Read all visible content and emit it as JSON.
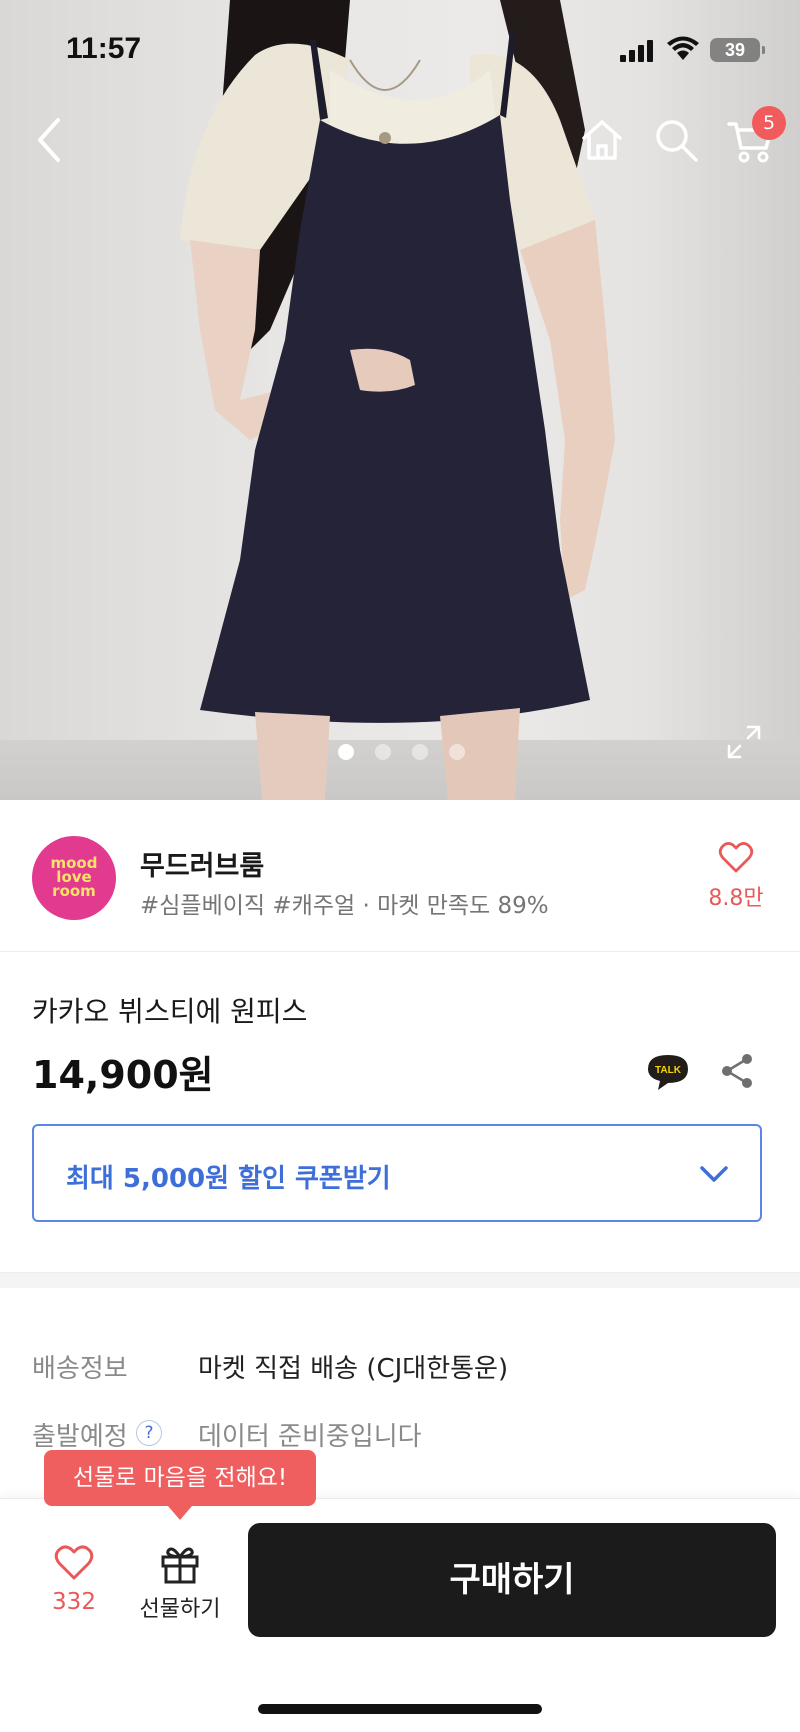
{
  "status_bar": {
    "time": "11:57",
    "battery": "39"
  },
  "cart": {
    "badge_count": "5"
  },
  "carousel": {
    "total": 4,
    "active_index": 0
  },
  "store": {
    "logo_lines": [
      "mood",
      "love",
      "room"
    ],
    "name": "무드러브룸",
    "tags": "#심플베이직 #캐주얼 · 마켓 만족도 89%",
    "favorite_count": "8.8만"
  },
  "product": {
    "title": "카카오 뷔스티에 원피스",
    "price": "14,900원",
    "talk_icon_label": "TALK",
    "coupon_label": "최대 5,000원 할인 쿠폰받기"
  },
  "delivery": {
    "shipping_label": "배송정보",
    "shipping_value": "마켓 직접 배송 (CJ대한통운)",
    "departure_label": "출발예정",
    "departure_value": "데이터 준비중입니다",
    "help_glyph": "?"
  },
  "tooltip": {
    "text": "선물로 마음을 전해요!"
  },
  "bottom_bar": {
    "like_count": "332",
    "gift_label": "선물하기",
    "buy_label": "구매하기"
  },
  "colors": {
    "accent_blue": "#3e6fd8",
    "accent_red": "#e85a5a",
    "badge_red": "#f25b5b",
    "buy_button": "#1b1b1b",
    "store_logo_bg": "#e23a8f"
  },
  "icons": [
    "back-icon",
    "home-icon",
    "search-icon",
    "cart-icon",
    "expand-icon",
    "heart-icon",
    "talk-icon",
    "share-icon",
    "chevron-down-icon",
    "help-icon",
    "gift-icon"
  ]
}
